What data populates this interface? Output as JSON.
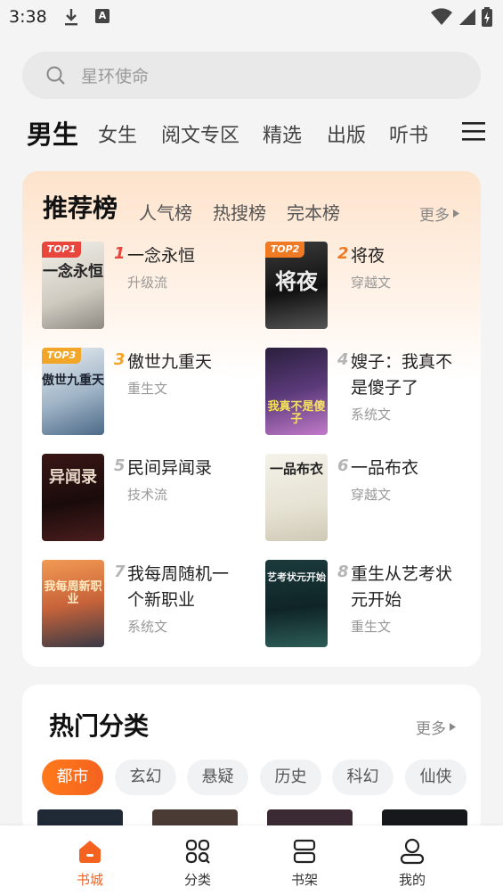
{
  "status": {
    "time": "3:38"
  },
  "search": {
    "placeholder": "星环使命"
  },
  "channel_tabs": [
    "男生",
    "女生",
    "阅文专区",
    "精选",
    "出版",
    "听书"
  ],
  "ranking": {
    "title": "推荐榜",
    "subtabs": [
      "人气榜",
      "热搜榜",
      "完本榜"
    ],
    "more": "更多",
    "books": [
      {
        "rank": "1",
        "badge": "TOP1",
        "title": "一念永恒",
        "tag": "升级流",
        "cover_text": "一念永恒"
      },
      {
        "rank": "2",
        "badge": "TOP2",
        "title": "将夜",
        "tag": "穿越文",
        "cover_text": "将夜"
      },
      {
        "rank": "3",
        "badge": "TOP3",
        "title": "傲世九重天",
        "tag": "重生文",
        "cover_text": "傲世九重天"
      },
      {
        "rank": "4",
        "badge": "",
        "title": "嫂子：我真不是傻子了",
        "tag": "系统文",
        "cover_text": "我真不是傻子"
      },
      {
        "rank": "5",
        "badge": "",
        "title": "民间异闻录",
        "tag": "技术流",
        "cover_text": "异闻录"
      },
      {
        "rank": "6",
        "badge": "",
        "title": "一品布衣",
        "tag": "穿越文",
        "cover_text": "一品布衣"
      },
      {
        "rank": "7",
        "badge": "",
        "title": "我每周随机一个新职业",
        "tag": "系统文",
        "cover_text": "我每周新职业"
      },
      {
        "rank": "8",
        "badge": "",
        "title": "重生从艺考状元开始",
        "tag": "重生文",
        "cover_text": "艺考状元开始"
      }
    ]
  },
  "categories": {
    "title": "热门分类",
    "more": "更多",
    "chips": [
      "都市",
      "玄幻",
      "悬疑",
      "历史",
      "科幻",
      "仙侠"
    ]
  },
  "bottom_nav": [
    "书城",
    "分类",
    "书架",
    "我的"
  ],
  "colors": {
    "accent": "#f4621f",
    "top1": "#e8453c",
    "top2": "#f07a23",
    "top3": "#f2a628"
  }
}
